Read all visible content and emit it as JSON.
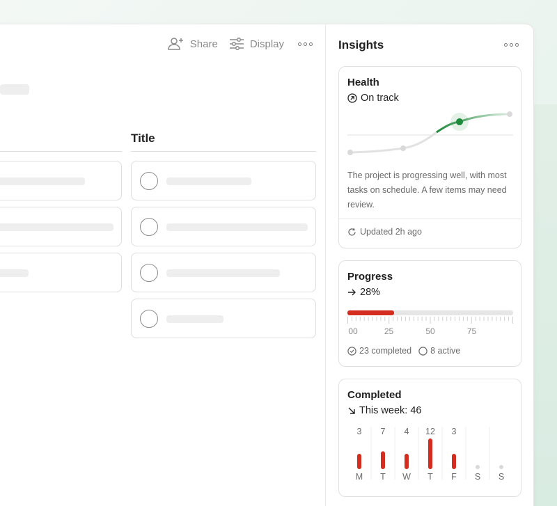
{
  "toolbar": {
    "share_label": "Share",
    "display_label": "Display"
  },
  "main": {
    "column_title": "Title"
  },
  "insights": {
    "title": "Insights",
    "health": {
      "title": "Health",
      "status": "On track",
      "description": "The project is progressing well, with most tasks on schedule. A few items may need review.",
      "updated": "Updated 2h ago",
      "accent": "#1e8a3c"
    },
    "progress": {
      "title": "Progress",
      "value_text": "28%",
      "percent": 28,
      "ticks": [
        "00",
        "25",
        "50",
        "75"
      ],
      "completed": "23 completed",
      "active": "8 active",
      "accent": "#d42c1e"
    },
    "completed": {
      "title": "Completed",
      "summary": "This week: 46",
      "days": [
        {
          "label": "M",
          "count": "3",
          "value": 3
        },
        {
          "label": "T",
          "count": "7",
          "value": 7
        },
        {
          "label": "W",
          "count": "4",
          "value": 4
        },
        {
          "label": "T",
          "count": "12",
          "value": 12
        },
        {
          "label": "F",
          "count": "3",
          "value": 3
        },
        {
          "label": "S",
          "count": "",
          "value": 0
        },
        {
          "label": "S",
          "count": "",
          "value": 0
        }
      ]
    }
  }
}
